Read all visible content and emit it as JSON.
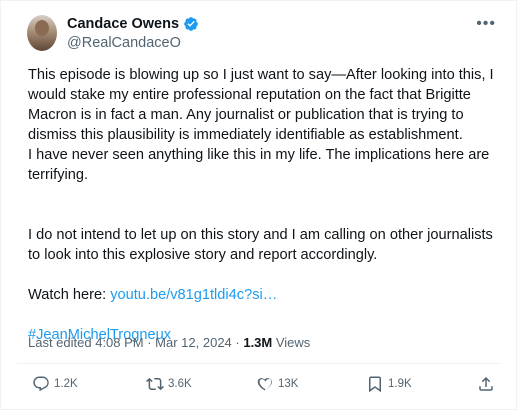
{
  "author": {
    "name": "Candace Owens",
    "handle": "@RealCandaceO"
  },
  "menu_icon": "more-horizontal-icon",
  "body": {
    "lines": [
      "This episode is blowing up so I just want to say—After looking into this, I",
      "would stake my entire professional reputation on the fact that Brigitte",
      "Macron is in fact a man. Any journalist or publication that is trying to",
      "dismiss this plausibility is immediately identifiable as establishment.",
      "I have never seen anything like this in my life. The implications here are",
      "terrifying."
    ],
    "para2_lines": [
      "I do not intend to let up on this story and I am calling on other journalists",
      "to look into this explosive story and report accordingly."
    ],
    "watch_prefix": "Watch here: ",
    "watch_link": "youtu.be/v81g1tldi4c?si…",
    "hashtag": "#JeanMichelTrogneux"
  },
  "meta": {
    "edited": "Last edited 4:08 PM · Mar 12, 2024 · ",
    "views_count": "1.3M",
    "views_label": " Views"
  },
  "actions": {
    "replies": "1.2K",
    "reposts": "3.6K",
    "likes": "13K",
    "bookmarks": "1.9K"
  },
  "colors": {
    "link": "#1d9bf0",
    "verified": "#1d9bf0",
    "secondary_text": "#536471"
  }
}
